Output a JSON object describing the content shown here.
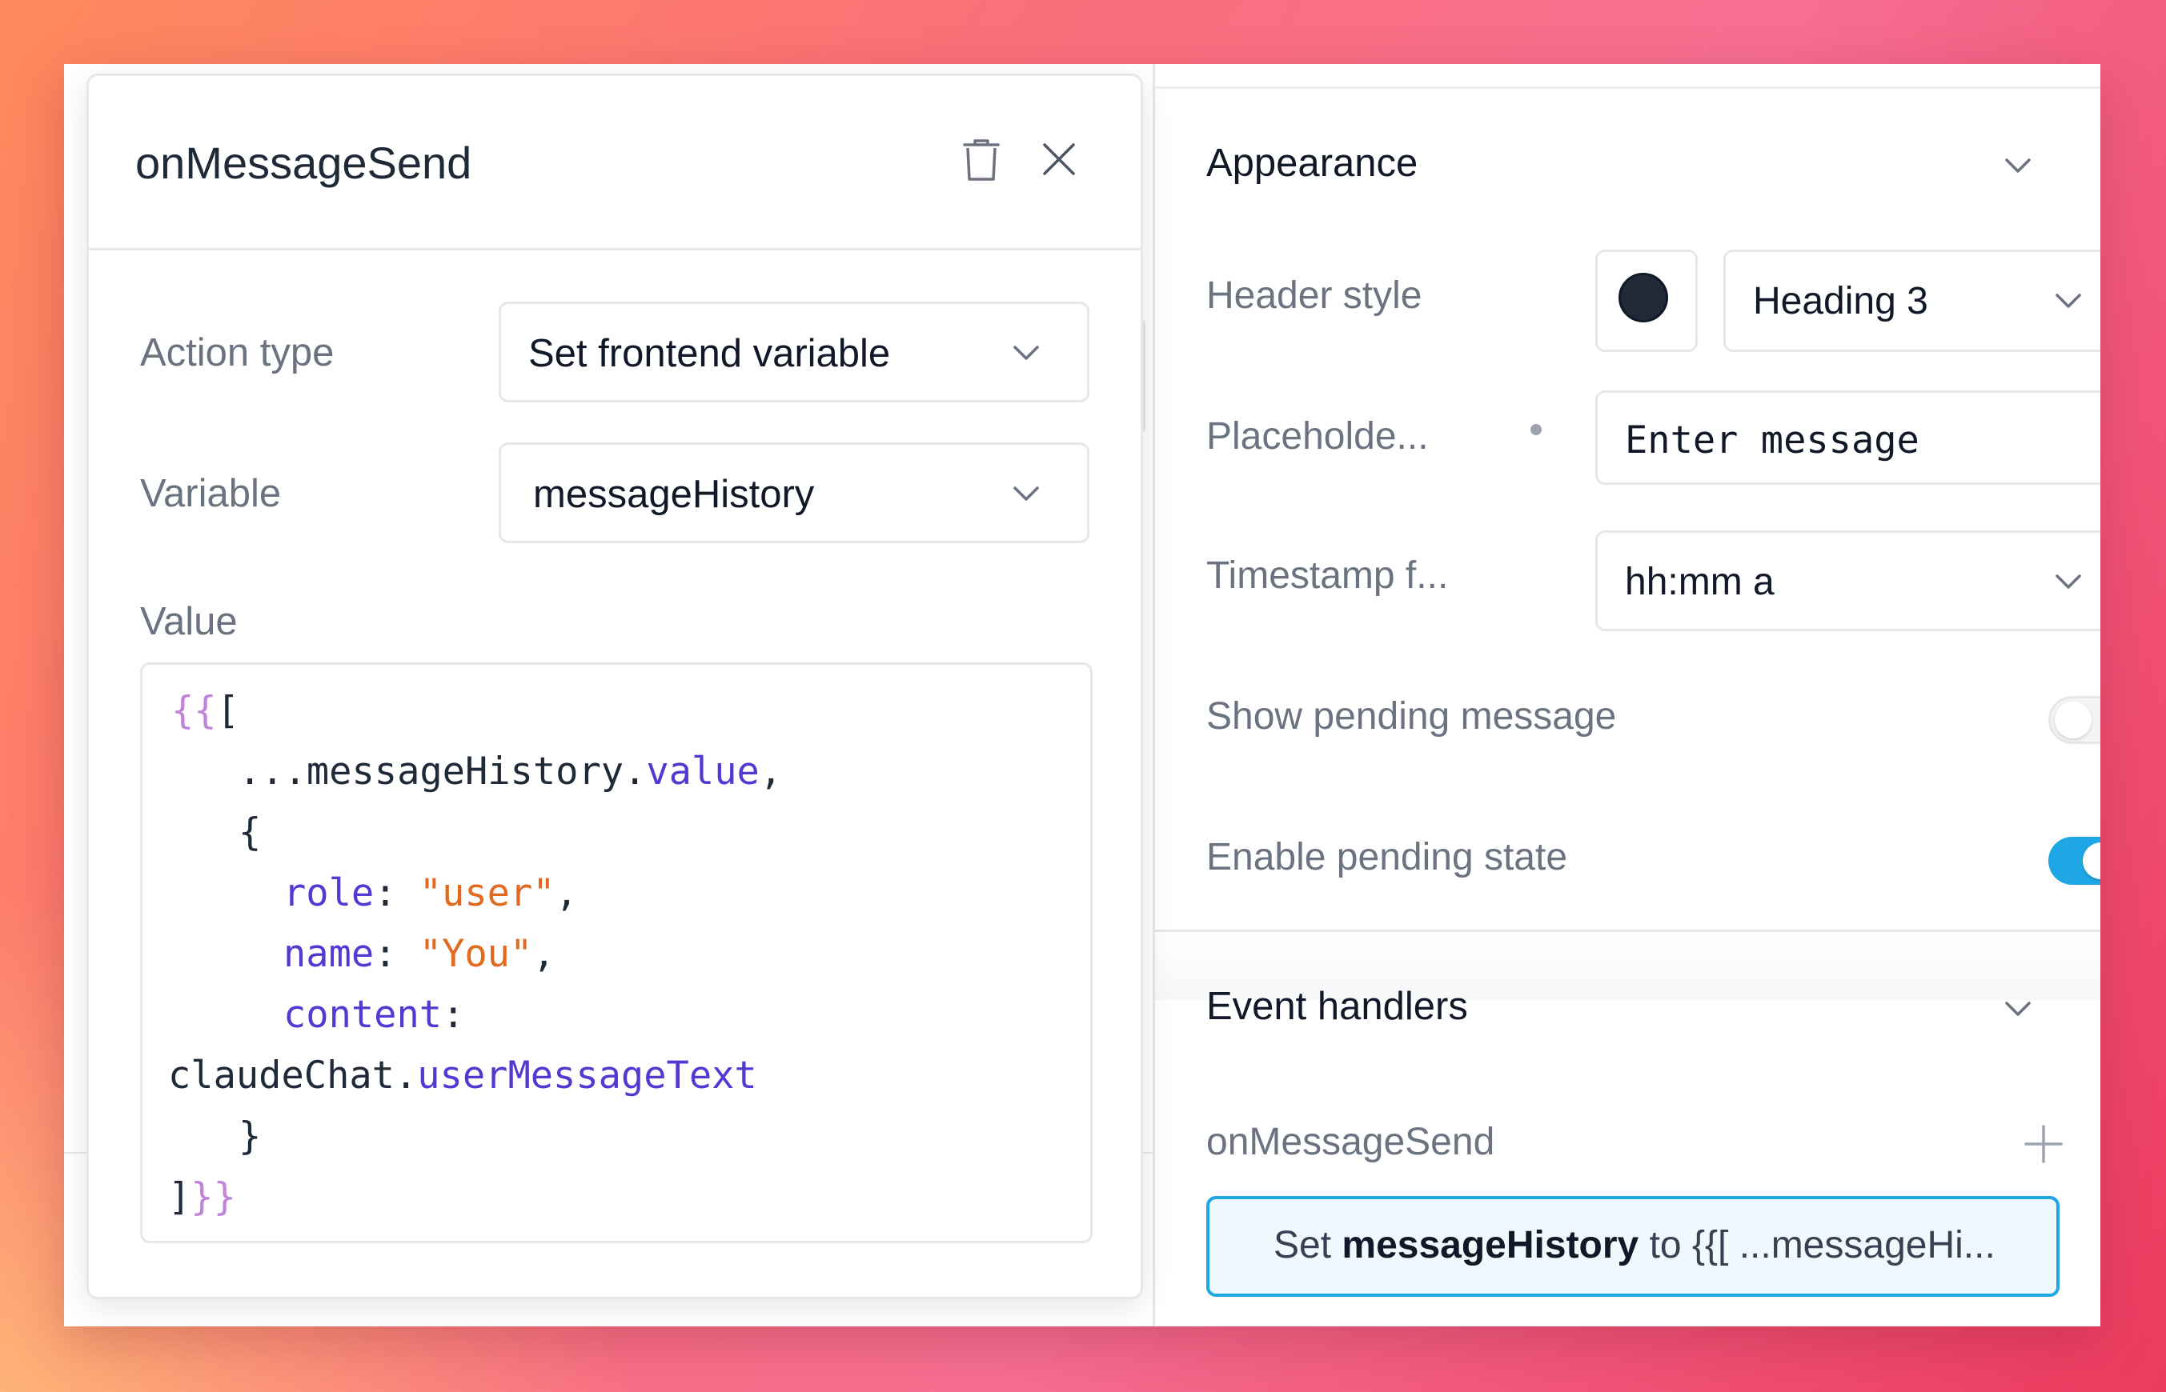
{
  "popover": {
    "title": "onMessageSend",
    "action_type_label": "Action type",
    "action_type_value": "Set frontend variable",
    "variable_label": "Variable",
    "variable_value": "messageHistory",
    "value_label": "Value",
    "code": {
      "l1_open": "{{",
      "l1_bracket": "[",
      "l2_text": "...messageHistory.",
      "l2_prop": "value",
      "l2_end": ",",
      "l3": "{",
      "l4_key": "role",
      "l4_sep": ": ",
      "l4_str": "\"user\"",
      "l4_end": ",",
      "l5_key": "name",
      "l5_sep": ": ",
      "l5_str": "\"You\"",
      "l5_end": ",",
      "l6_key": "content",
      "l6_sep": ":",
      "l7_text": "claudeChat.",
      "l7_prop": "userMessageText",
      "l8": "}",
      "l9_bracket": "]",
      "l9_close": "}}"
    }
  },
  "appearance": {
    "title": "Appearance",
    "header_style_label": "Header style",
    "header_style_color": "#1f2937",
    "header_style_value": "Heading 3",
    "placeholder_label": "Placeholde...",
    "placeholder_value": "Enter message",
    "timestamp_label": "Timestamp f...",
    "timestamp_value": "hh:mm a",
    "show_pending_label": "Show pending message",
    "show_pending_on": false,
    "enable_pending_label": "Enable pending state",
    "enable_pending_on": true
  },
  "event_handlers": {
    "title": "Event handlers",
    "event_name": "onMessageSend",
    "handler_prefix": "Set ",
    "handler_variable": "messageHistory",
    "handler_suffix": " to {{[ ...messageHi..."
  },
  "colors": {
    "accent": "#1ea7e4",
    "code_property": "#4f3bd1",
    "code_string": "#e06a1f",
    "code_brace": "#c084d8"
  },
  "icons": [
    "trash-icon",
    "close-icon",
    "chevron-down-icon",
    "plus-icon"
  ]
}
